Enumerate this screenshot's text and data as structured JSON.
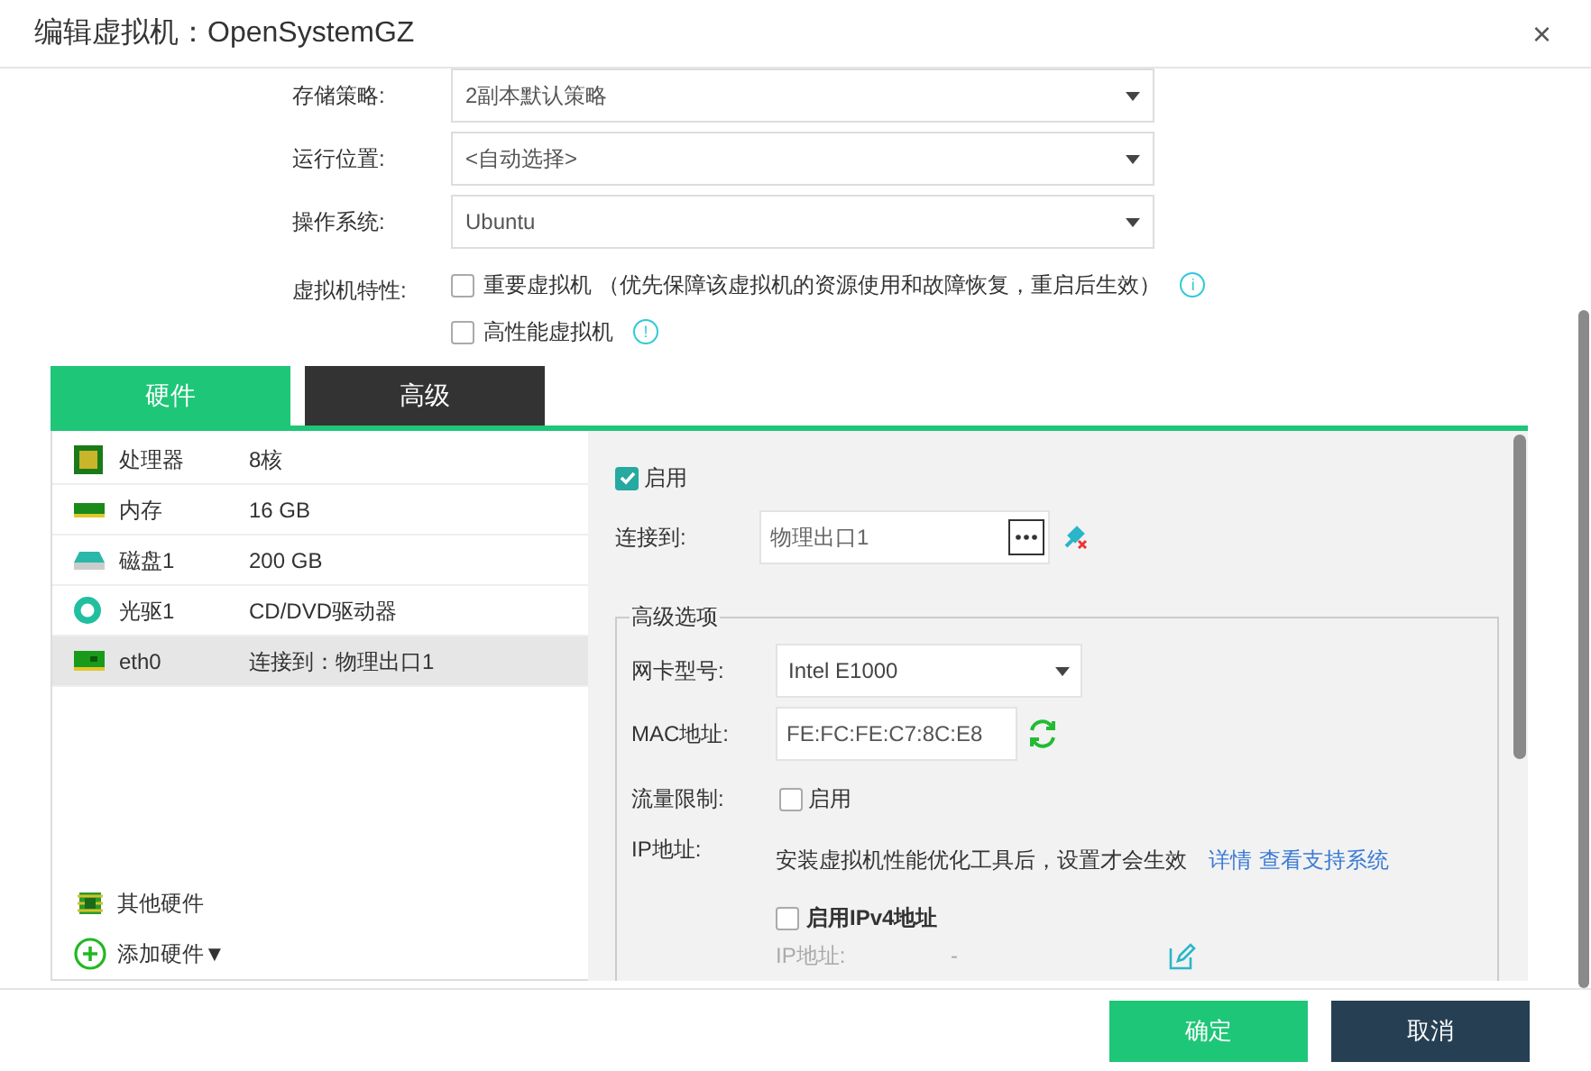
{
  "window": {
    "title": "编辑虚拟机：OpenSystemGZ",
    "close": "×"
  },
  "form": [
    {
      "label": "存储策略:",
      "kind": "select",
      "value": "2副本默认策略"
    },
    {
      "label": "运行位置:",
      "kind": "select",
      "value": "<自动选择>"
    },
    {
      "label": "操作系统:",
      "kind": "select",
      "value": "Ubuntu"
    }
  ],
  "features": {
    "label": "虚拟机特性:",
    "options": [
      {
        "label": "重要虚拟机 （优先保障该虚拟机的资源使用和故障恢复，重启后生效）",
        "checked": false,
        "info": "i"
      },
      {
        "label": "高性能虚拟机",
        "checked": false,
        "info": "!"
      }
    ]
  },
  "tabs": [
    {
      "label": "硬件",
      "selected": true
    },
    {
      "label": "高级",
      "selected": false
    }
  ],
  "hardware": [
    {
      "kind": "cpu",
      "name": "处理器",
      "value": "8核",
      "selected": false
    },
    {
      "kind": "memory",
      "name": "内存",
      "value": "16 GB",
      "selected": false
    },
    {
      "kind": "disk",
      "name": "磁盘1",
      "value": "200 GB",
      "selected": false
    },
    {
      "kind": "cdrom",
      "name": "光驱1",
      "value": "CD/DVD驱动器",
      "selected": false
    },
    {
      "kind": "nic",
      "name": "eth0",
      "value": "连接到：物理出口1",
      "selected": true
    }
  ],
  "hardware_actions": [
    {
      "kind": "other",
      "label": "其他硬件"
    },
    {
      "kind": "add",
      "label": "添加硬件▼"
    }
  ],
  "nic": {
    "enabled": {
      "label": "启用",
      "checked": true
    },
    "connect": {
      "label": "连接到:",
      "value": "物理出口1"
    },
    "advanced": {
      "legend": "高级选项",
      "model": {
        "label": "网卡型号:",
        "value": "Intel E1000"
      },
      "mac": {
        "label": "MAC地址:",
        "value": "FE:FC:FE:C7:8C:E8"
      },
      "traffic": {
        "label": "流量限制:",
        "option": "启用",
        "checked": false
      },
      "ip": {
        "label": "IP地址:",
        "note": "安装虚拟机性能优化工具后，设置才会生效",
        "links": [
          "详情",
          "查看支持系统"
        ]
      },
      "ipv4": {
        "label": "启用IPv4地址",
        "checked": false
      },
      "ipv4_address": {
        "label": "IP地址:",
        "value": "-"
      }
    }
  },
  "buttons": [
    {
      "kind": "primary",
      "label": "确定"
    },
    {
      "kind": "secondary",
      "label": "取消"
    }
  ]
}
